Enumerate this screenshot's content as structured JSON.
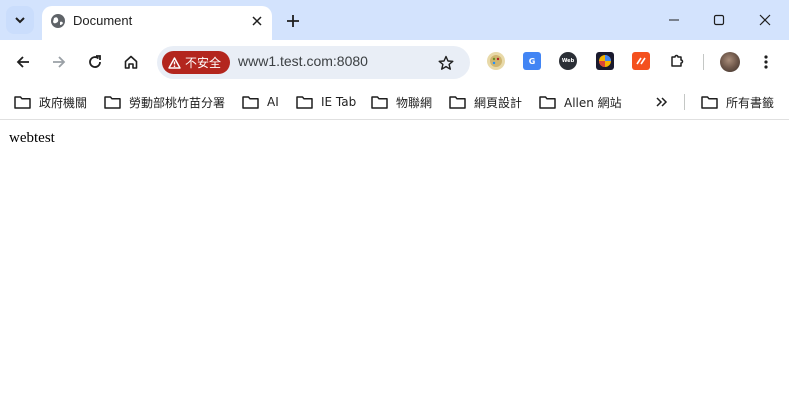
{
  "tab": {
    "title": "Document",
    "close_icon": "close-icon",
    "new_tab_icon": "plus-icon"
  },
  "window": {
    "minimize_icon": "minimize-icon",
    "maximize_icon": "maximize-icon",
    "close_icon": "close-icon"
  },
  "toolbar": {
    "back_icon": "arrow-left-icon",
    "forward_icon": "arrow-right-icon",
    "reload_icon": "reload-icon",
    "home_icon": "home-icon",
    "security_label": "不安全",
    "url": "www1.test.com:8080",
    "extensions": [
      {
        "name": "palette-extension-icon"
      },
      {
        "name": "google-translate-extension-icon"
      },
      {
        "name": "web-extension-icon"
      },
      {
        "name": "colorful-globe-extension-icon"
      },
      {
        "name": "orange-extension-icon"
      },
      {
        "name": "puzzle-icon"
      }
    ],
    "menu_icon": "kebab-menu-icon"
  },
  "bookmarks": {
    "items": [
      {
        "label": "政府機關"
      },
      {
        "label": "勞動部桃竹苗分署"
      },
      {
        "label": "AI"
      },
      {
        "label": "IE Tab"
      },
      {
        "label": "物聯網"
      },
      {
        "label": "網頁設計"
      },
      {
        "label": "Allen 網站"
      }
    ],
    "all_bookmarks": "所有書籤"
  },
  "content": {
    "text": "webtest"
  },
  "colors": {
    "titlebar": "#d3e3fd",
    "omnibox": "#e9eef6",
    "security_chip": "#b3261e"
  }
}
